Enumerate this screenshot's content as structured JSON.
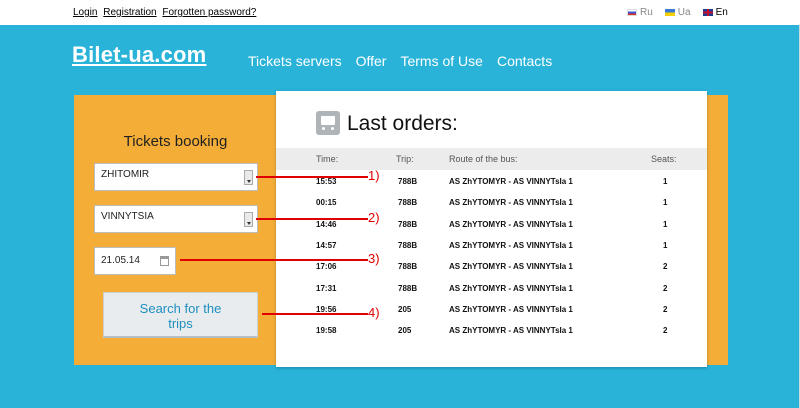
{
  "topbar": {
    "links": [
      "Login",
      "Registration",
      "Forgotten password?"
    ],
    "languages": [
      {
        "label": "Ru",
        "active": false
      },
      {
        "label": "Ua",
        "active": false
      },
      {
        "label": "En",
        "active": true
      }
    ]
  },
  "header": {
    "logo": "Bilet-ua.com",
    "nav": [
      "Tickets servers",
      "Offer",
      "Terms of Use",
      "Contacts"
    ]
  },
  "booking": {
    "title": "Tickets booking",
    "from_value": "ZHITOMIR",
    "to_value": "VINNYTSIA",
    "date_value": "21.05.14",
    "search_label_line1": "Search for the",
    "search_label_line2": "trips"
  },
  "orders": {
    "title": "Last orders:",
    "columns": [
      "Time:",
      "Trip:",
      "Route of the bus:",
      "Seats:"
    ],
    "rows": [
      {
        "time": "15:53",
        "trip": "788B",
        "route": "AS ZhYTOMYR - AS VINNYTsIa 1",
        "seats": "1"
      },
      {
        "time": "00:15",
        "trip": "788B",
        "route": "AS ZhYTOMYR - AS VINNYTsIa 1",
        "seats": "1"
      },
      {
        "time": "14:46",
        "trip": "788B",
        "route": "AS ZhYTOMYR - AS VINNYTsIa 1",
        "seats": "1"
      },
      {
        "time": "14:57",
        "trip": "788B",
        "route": "AS ZhYTOMYR - AS VINNYTsIa 1",
        "seats": "1"
      },
      {
        "time": "17:06",
        "trip": "788B",
        "route": "AS ZhYTOMYR - AS VINNYTsIa 1",
        "seats": "2"
      },
      {
        "time": "17:31",
        "trip": "788B",
        "route": "AS ZhYTOMYR - AS VINNYTsIa 1",
        "seats": "2"
      },
      {
        "time": "19:56",
        "trip": "205",
        "route": "AS ZhYTOMYR - AS VINNYTsIa 1",
        "seats": "2"
      },
      {
        "time": "19:58",
        "trip": "205",
        "route": "AS ZhYTOMYR - AS VINNYTsIa 1",
        "seats": "2"
      }
    ]
  },
  "annotations": [
    "1)",
    "2)",
    "3)",
    "4)"
  ],
  "colors": {
    "main_bg": "#29b3d9",
    "panel": "#f4ad36",
    "annotation": "#e00000"
  }
}
